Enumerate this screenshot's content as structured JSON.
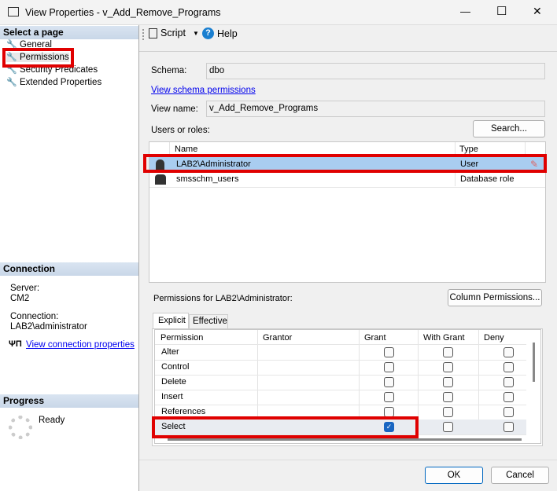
{
  "window": {
    "title": "View Properties - v_Add_Remove_Programs",
    "minimize": "—",
    "maximize": "☐",
    "close": "✕"
  },
  "left": {
    "select_header": "Select a page",
    "pages": [
      {
        "label": "General"
      },
      {
        "label": "Permissions"
      },
      {
        "label": "Security Predicates"
      },
      {
        "label": "Extended Properties"
      }
    ],
    "connection_header": "Connection",
    "server_label": "Server:",
    "server_value": "CM2",
    "connection_label": "Connection:",
    "connection_value": "LAB2\\administrator",
    "view_connection_link": "View connection properties",
    "progress_header": "Progress",
    "progress_status": "Ready"
  },
  "toolbar": {
    "script": "Script",
    "help": "Help"
  },
  "form": {
    "schema_label": "Schema:",
    "schema_value": "dbo",
    "schema_link": "View schema permissions",
    "view_name_label": "View name:",
    "view_name_value": "v_Add_Remove_Programs",
    "users_label": "Users or roles:",
    "search_button": "Search..."
  },
  "users_grid": {
    "headers": {
      "name": "Name",
      "type": "Type"
    },
    "rows": [
      {
        "name": "LAB2\\Administrator",
        "type": "User",
        "selected": true
      },
      {
        "name": "smsschm_users",
        "type": "Database role",
        "selected": false
      }
    ]
  },
  "permissions": {
    "label": "Permissions for LAB2\\Administrator:",
    "column_permissions_button": "Column Permissions...",
    "tabs": [
      "Explicit",
      "Effective"
    ],
    "headers": [
      "Permission",
      "Grantor",
      "Grant",
      "With Grant",
      "Deny"
    ],
    "rows": [
      {
        "permission": "Alter",
        "grantor": "",
        "grant": false,
        "with_grant": false,
        "deny": false
      },
      {
        "permission": "Control",
        "grantor": "",
        "grant": false,
        "with_grant": false,
        "deny": false
      },
      {
        "permission": "Delete",
        "grantor": "",
        "grant": false,
        "with_grant": false,
        "deny": false
      },
      {
        "permission": "Insert",
        "grantor": "",
        "grant": false,
        "with_grant": false,
        "deny": false
      },
      {
        "permission": "References",
        "grantor": "",
        "grant": false,
        "with_grant": false,
        "deny": false
      },
      {
        "permission": "Select",
        "grantor": "",
        "grant": true,
        "with_grant": false,
        "deny": false
      }
    ]
  },
  "footer": {
    "ok": "OK",
    "cancel": "Cancel"
  }
}
